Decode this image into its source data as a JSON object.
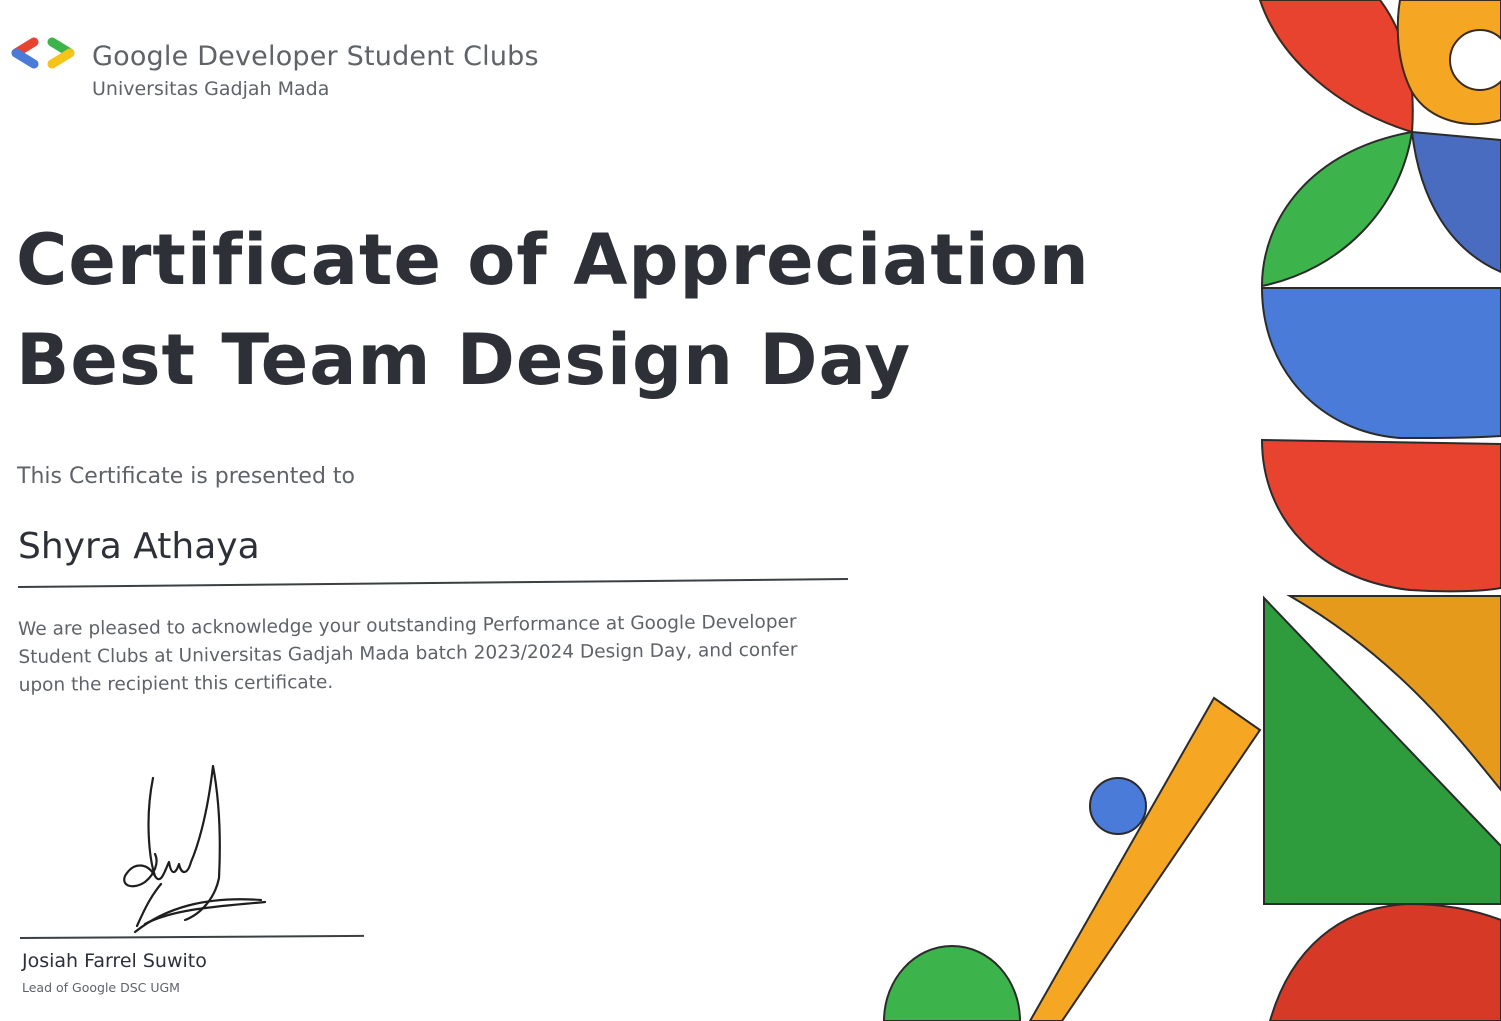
{
  "header": {
    "org_name": "Google Developer Student Clubs",
    "org_sub": "Universitas Gadjah Mada",
    "logo_icon": "gdsc-brackets-icon"
  },
  "certificate": {
    "title_line1": "Certificate of Appreciation",
    "title_line2": "Best Team Design Day",
    "presented_to": "This Certificate is presented to",
    "recipient": "Shyra Athaya",
    "body": "We are pleased to acknowledge your outstanding Performance at Google Developer Student Clubs at Universitas Gadjah Mada batch 2023/2024 Design Day, and confer upon the recipient this certificate."
  },
  "signatory": {
    "name": "Josiah Farrel Suwito",
    "role": "Lead of Google DSC UGM"
  },
  "colors": {
    "red": "#e8432e",
    "yellow": "#f5a623",
    "green": "#3cb44b",
    "blue": "#4a7bd8",
    "text_dark": "#2e3038",
    "text_gray": "#5f6368"
  }
}
